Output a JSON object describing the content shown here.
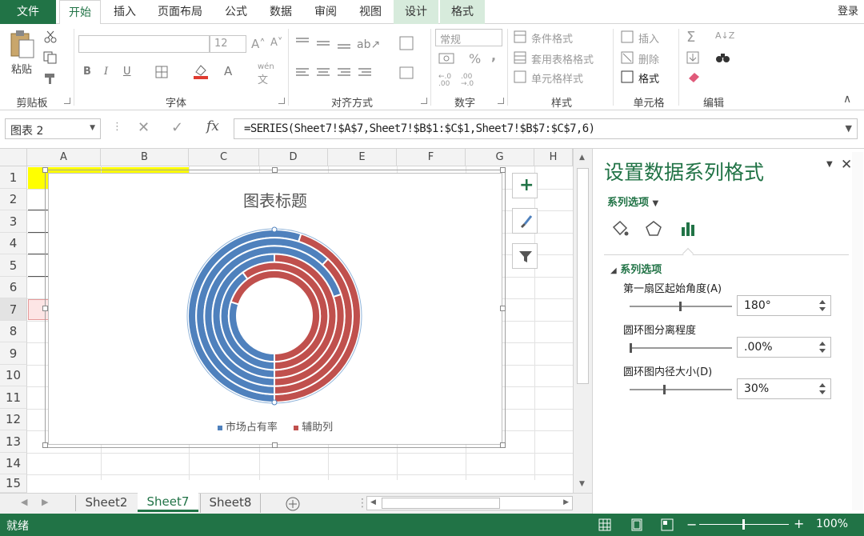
{
  "tabs": {
    "file": "文件",
    "home": "开始",
    "insert": "插入",
    "page_layout": "页面布局",
    "formulas": "公式",
    "data": "数据",
    "review": "审阅",
    "view": "视图",
    "design": "设计",
    "format": "格式",
    "login": "登录"
  },
  "ribbon": {
    "clipboard": {
      "paste": "粘贴",
      "label": "剪贴板"
    },
    "font": {
      "size": "12",
      "bold": "B",
      "italic": "I",
      "underline": "U",
      "label": "字体",
      "wen": "wén",
      "wen_char": "文"
    },
    "alignment": {
      "label": "对齐方式"
    },
    "number": {
      "format": "常规",
      "percent": "%",
      "comma": ",",
      "label": "数字"
    },
    "styles": {
      "conditional": "条件格式",
      "table": "套用表格格式",
      "cell": "单元格样式",
      "label": "样式"
    },
    "cells": {
      "insert": "插入",
      "delete": "删除",
      "format": "格式",
      "label": "单元格"
    },
    "editing": {
      "label": "编辑"
    }
  },
  "formula_bar": {
    "name_box": "图表 2",
    "formula": "=SERIES(Sheet7!$A$7,Sheet7!$B$1:$C$1,Sheet7!$B$7:$C$7,6)",
    "fx": "fx"
  },
  "grid": {
    "columns": [
      "A",
      "B",
      "C",
      "D",
      "E",
      "F",
      "G",
      "H"
    ],
    "rows": [
      "1",
      "2",
      "3",
      "4",
      "5",
      "6",
      "7",
      "8",
      "9",
      "10",
      "11",
      "12",
      "13",
      "14",
      "15"
    ]
  },
  "chart": {
    "title": "图表标题",
    "legend": [
      {
        "label": "市场占有率",
        "color": "#4f81bd"
      },
      {
        "label": "辅助列",
        "color": "#c0504d"
      }
    ]
  },
  "chart_data": {
    "type": "doughnut",
    "title": "图表标题",
    "series_names": [
      "市场占有率",
      "辅助列"
    ],
    "first_slice_angle": 180,
    "hole_size_percent": 30,
    "rings": [
      {
        "ring": 1,
        "values": [
          55,
          45
        ]
      },
      {
        "ring": 2,
        "values": [
          62,
          38
        ]
      },
      {
        "ring": 3,
        "values": [
          70,
          30
        ]
      },
      {
        "ring": 4,
        "values": [
          50,
          50
        ]
      },
      {
        "ring": 5,
        "values": [
          40,
          60
        ]
      },
      {
        "ring": 6,
        "values": [
          30,
          70
        ]
      }
    ]
  },
  "pane": {
    "title": "设置数据系列格式",
    "options_dropdown": "系列选项",
    "section": "系列选项",
    "angle_label": "第一扇区起始角度(A)",
    "angle_value": "180°",
    "explosion_label": "圆环图分离程度",
    "explosion_value": ".00%",
    "hole_label": "圆环图内径大小(D)",
    "hole_value": "30%"
  },
  "sheets": [
    "Sheet2",
    "Sheet7",
    "Sheet8"
  ],
  "active_sheet": "Sheet7",
  "status": {
    "ready": "就绪",
    "zoom": "100%"
  },
  "colors": {
    "accent": "#217346",
    "blue": "#4f81bd",
    "red": "#c0504d"
  }
}
